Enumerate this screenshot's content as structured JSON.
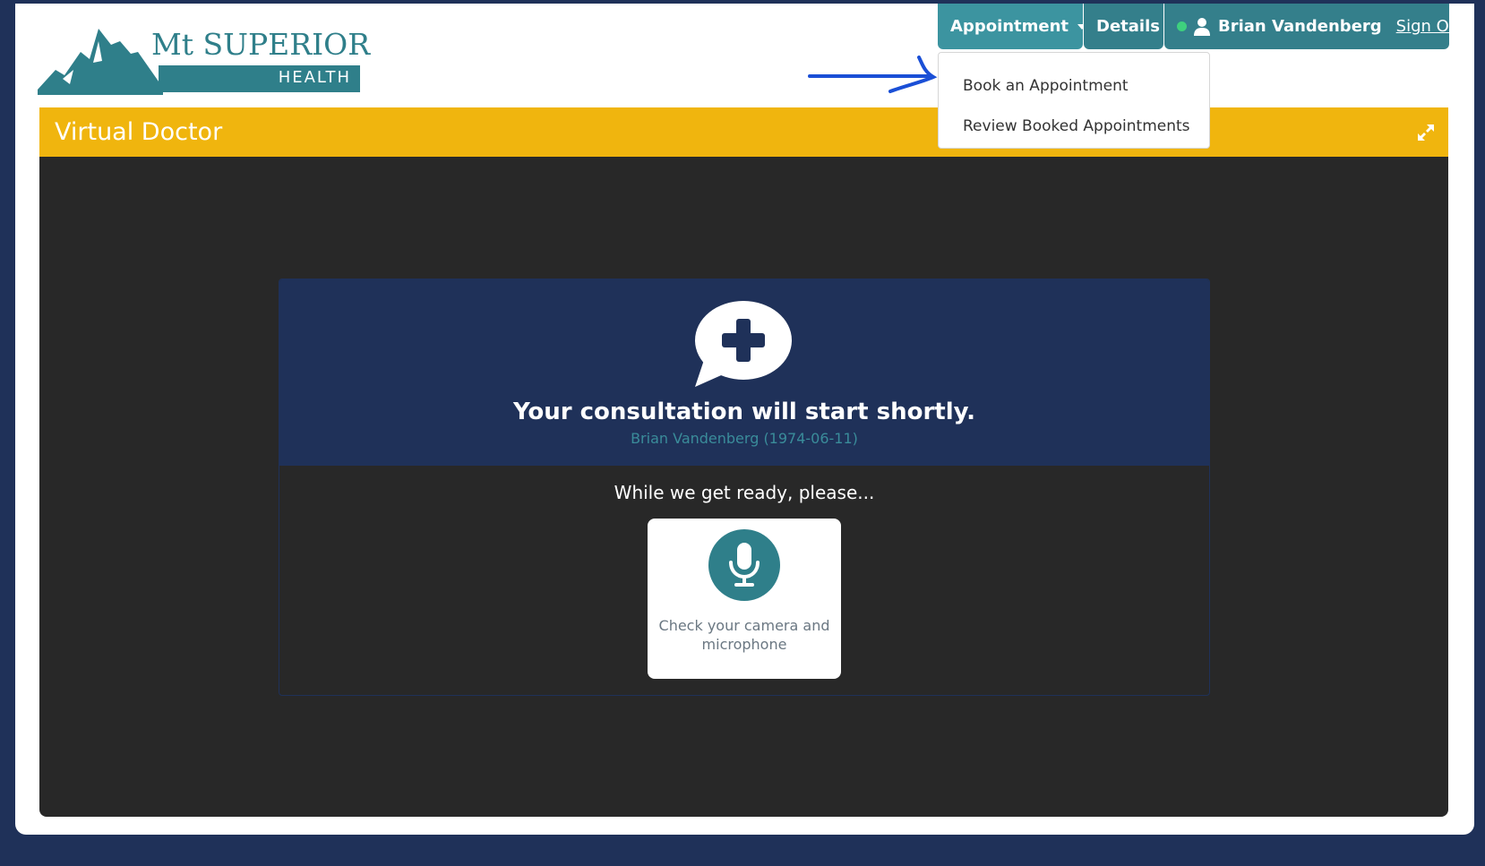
{
  "brand": {
    "name": "Mt SUPERIOR",
    "sub": "HEALTH"
  },
  "nav": {
    "appointment_label": "Appointment",
    "details_label": "Details",
    "user_name": "Brian Vandenberg",
    "signout_label": "Sign Out",
    "status_color": "#3ed07e"
  },
  "dropdown": {
    "items": [
      {
        "label": "Book an Appointment"
      },
      {
        "label": "Review Booked Appointments"
      }
    ]
  },
  "panel": {
    "title": "Virtual Doctor",
    "consult_title": "Your consultation will start shortly.",
    "patient": "Brian Vandenberg (1974-06-11)",
    "ready_text": "While we get ready, please...",
    "check_label": "Check your camera and microphone"
  },
  "colors": {
    "navy": "#1f3159",
    "teal": "#2f7f8a",
    "gold": "#f0b50e",
    "dark": "#282828"
  },
  "icons": [
    "mountain-logo-icon",
    "chevron-down-icon",
    "user-icon",
    "expand-icon",
    "medical-chat-icon",
    "microphone-icon"
  ]
}
